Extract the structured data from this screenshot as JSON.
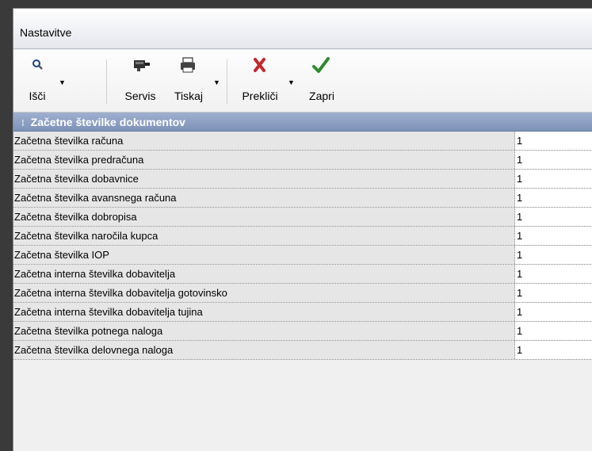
{
  "window": {
    "title": "Nastavitve"
  },
  "toolbar": {
    "buttons": [
      {
        "label": "Išči",
        "icon": "search-icon",
        "has_dropdown": true
      },
      {
        "label": "Servis",
        "icon": "tools-icon",
        "has_dropdown": false
      },
      {
        "label": "Tiskaj",
        "icon": "printer-icon",
        "has_dropdown": true
      },
      {
        "label": "Prekliči",
        "icon": "cancel-icon",
        "has_dropdown": true
      },
      {
        "label": "Zapri",
        "icon": "checkmark-icon",
        "has_dropdown": false
      }
    ]
  },
  "grid": {
    "section_title": "Začetne številke dokumentov",
    "rows": [
      {
        "label": "Začetna številka računa",
        "value": "1"
      },
      {
        "label": "Začetna številka predračuna",
        "value": "1"
      },
      {
        "label": "Začetna številka dobavnice",
        "value": "1"
      },
      {
        "label": "Začetna številka avansnega računa",
        "value": "1"
      },
      {
        "label": "Začetna številka dobropisa",
        "value": "1"
      },
      {
        "label": "Začetna številka naročila kupca",
        "value": "1"
      },
      {
        "label": "Začetna številka IOP",
        "value": "1"
      },
      {
        "label": "Začetna interna številka dobavitelja",
        "value": "1"
      },
      {
        "label": "Začetna interna številka dobavitelja gotovinsko",
        "value": "1"
      },
      {
        "label": "Začetna interna številka dobavitelja tujina",
        "value": "1"
      },
      {
        "label": "Začetna številka potnega naloga",
        "value": "1"
      },
      {
        "label": "Začetna številka delovnega naloga",
        "value": "1"
      }
    ]
  },
  "colors": {
    "section_header": "#8c9fc4",
    "label_cell": "#e6e6e6",
    "cancel_icon": "#c0282c",
    "check_icon": "#2e8b2e"
  }
}
